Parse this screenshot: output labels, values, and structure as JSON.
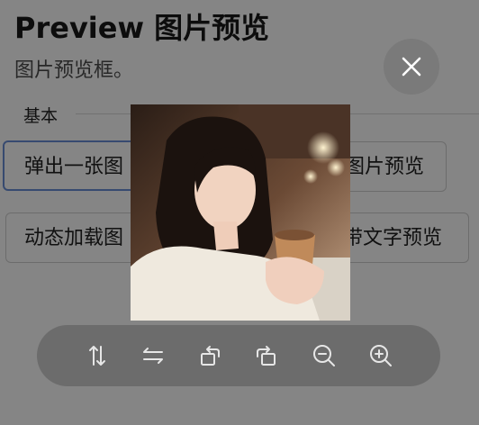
{
  "page": {
    "title": "Preview 图片预览",
    "subtitle": "图片预览框。"
  },
  "section": {
    "label": "基本"
  },
  "buttons": {
    "popup_one": "弹出一张图",
    "right_one": "图片预览",
    "dynamic": "动态加载图",
    "with_text": "带文字预览"
  },
  "viewer": {
    "close_icon": "close-icon",
    "image_subject": "woman-holding-coffee-cup",
    "toolbar": [
      {
        "name": "flip-vertical-icon"
      },
      {
        "name": "flip-horizontal-icon"
      },
      {
        "name": "rotate-left-icon"
      },
      {
        "name": "rotate-right-icon"
      },
      {
        "name": "zoom-out-icon"
      },
      {
        "name": "zoom-in-icon"
      }
    ]
  },
  "colors": {
    "overlay": "#000000",
    "primary_border": "#6a8fd6",
    "toolbar_bg": "#6c6c6c"
  }
}
